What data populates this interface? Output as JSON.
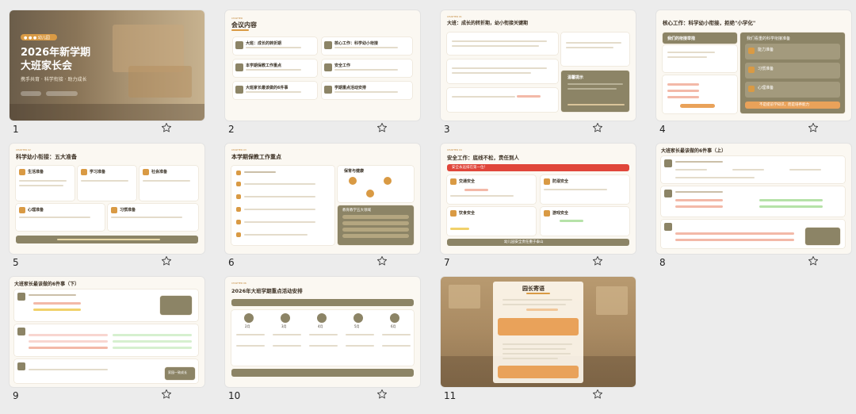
{
  "thumbnails": [
    {
      "number": "1",
      "badge": "● ● ● 幼儿园",
      "title": "2026年新学期",
      "title2": "大班家长会",
      "subtitle": "携手共育 · 科学衔接 · 助力成长"
    },
    {
      "number": "2",
      "title": "会议内容",
      "items": [
        {
          "no": "01",
          "label": "大班：成长的转折期"
        },
        {
          "no": "02",
          "label": "核心工作：科学幼小衔接"
        },
        {
          "no": "03",
          "label": "本学期保教工作重点"
        },
        {
          "no": "04",
          "label": "安全工作"
        },
        {
          "no": "05",
          "label": "大班家长最该做的6件事"
        },
        {
          "no": "06",
          "label": "学期重点活动安排"
        }
      ]
    },
    {
      "number": "3",
      "title": "大班：成长的转折期，幼小衔接关键期",
      "tip": "温馨提示"
    },
    {
      "number": "4",
      "title": "核心工作：科学幼小衔接，拒绝\"小学化\"",
      "left_head": "我们的衔接举措",
      "right_head": "我们看重的科学衔接准备",
      "right_items": [
        "能力准备",
        "习惯准备",
        "心理准备"
      ],
      "footer": "不是提前学知识，而是培养能力"
    },
    {
      "number": "5",
      "title": "科学幼小衔接：五大准备",
      "cards": [
        "生活准备",
        "学习准备",
        "社会准备",
        "心理准备",
        "习惯准备"
      ]
    },
    {
      "number": "6",
      "title": "本学期保教工作重点",
      "side_head": "保育与健康",
      "side_bottom": "教育教学五大领域"
    },
    {
      "number": "7",
      "title": "安全工作：底线不松，责任到人",
      "banner": "安全永远排在第一位！",
      "quads": [
        "交通安全",
        "防溺安全",
        "饮食安全",
        "游戏安全"
      ],
      "footer": "幼儿园安全责任重于泰山"
    },
    {
      "number": "8",
      "title": "大班家长最该做的6件事（上）"
    },
    {
      "number": "9",
      "title": "大班家长最该做的6件事（下）",
      "side_note": "家园一致成长"
    },
    {
      "number": "10",
      "title": "2026年大班学期重点活动安排",
      "months": [
        "2月",
        "3月",
        "4月",
        "5月",
        "6月"
      ]
    },
    {
      "number": "11",
      "title": "园长寄语"
    }
  ]
}
